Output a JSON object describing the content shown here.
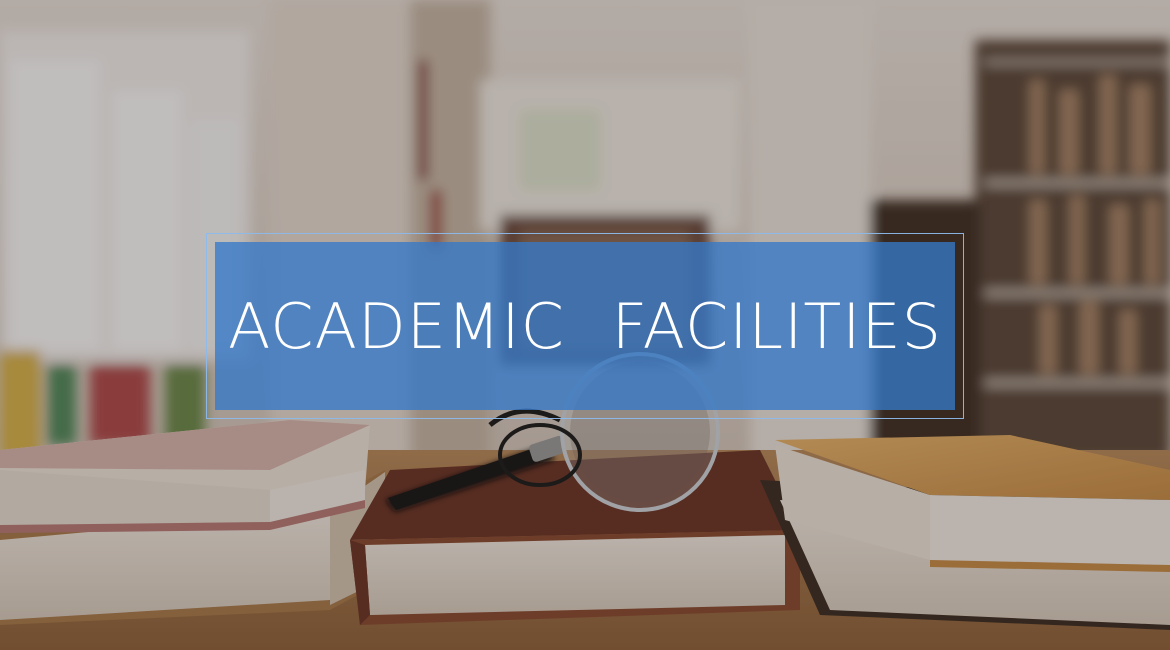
{
  "banner": {
    "title": "ACADEMIC  FACILITIES"
  },
  "colors": {
    "banner_fill": "#3478c8",
    "banner_border": "#8cb9eb",
    "title_text": "#ffffff"
  },
  "scene": {
    "description_icons": [
      "bookshelf",
      "books",
      "magnifying-glass"
    ]
  }
}
